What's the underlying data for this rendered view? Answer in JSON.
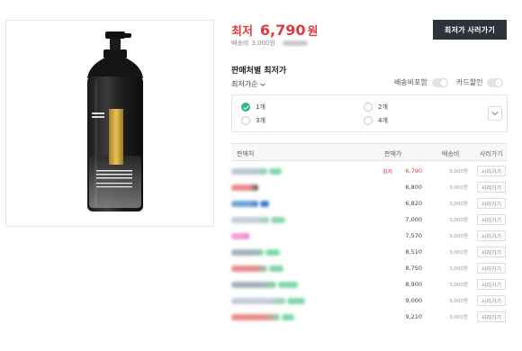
{
  "product": {
    "image_alt": "Product image"
  },
  "price": {
    "label": "최저",
    "value": "6,790",
    "unit": "원"
  },
  "shipping": {
    "label": "배송비",
    "value": "3,000원"
  },
  "buy_button": "최저가 사러가기",
  "section_title": "판매처별 최저가",
  "sort": {
    "label": "최저가순"
  },
  "toggles": [
    {
      "label": "배송비포함"
    },
    {
      "label": "카드할인"
    }
  ],
  "quantity_options": [
    {
      "label": "1개",
      "selected": true
    },
    {
      "label": "2개",
      "selected": false
    },
    {
      "label": "3개",
      "selected": false
    },
    {
      "label": "4개",
      "selected": false
    }
  ],
  "table": {
    "headers": {
      "seller": "판매처",
      "price": "판매가",
      "shipping": "배송비",
      "go": "사러가기"
    },
    "lowest_tag": "최저",
    "rows": [
      {
        "price": "6,790",
        "shipping": "3,000원",
        "go": "사러가기",
        "lowest": true,
        "seller_color": "#b9c7d6",
        "seller_accent": "#7fd7a8"
      },
      {
        "price": "6,800",
        "shipping": "3,000원",
        "go": "사러가기",
        "lowest": false,
        "seller_color": "#e88a8a",
        "seller_accent": "#555555"
      },
      {
        "price": "6,820",
        "shipping": "3,000원",
        "go": "사러가기",
        "lowest": false,
        "seller_color": "#6aa6d8",
        "seller_accent": "#3a7bd5"
      },
      {
        "price": "7,000",
        "shipping": "3,000원",
        "go": "사러가기",
        "lowest": false,
        "seller_color": "#c6ccd6",
        "seller_accent": "#8ad9b0"
      },
      {
        "price": "7,570",
        "shipping": "3,000원",
        "go": "사러가기",
        "lowest": false,
        "seller_color": "#f09ad8",
        "seller_accent": "#e86ac9"
      },
      {
        "price": "8,510",
        "shipping": "3,000원",
        "go": "사러가기",
        "lowest": false,
        "seller_color": "#a5b0bc",
        "seller_accent": "#7fd7a8"
      },
      {
        "price": "8,750",
        "shipping": "3,000원",
        "go": "사러가기",
        "lowest": false,
        "seller_color": "#e88a8a",
        "seller_accent": "#7fd7a8"
      },
      {
        "price": "8,900",
        "shipping": "3,000원",
        "go": "사러가기",
        "lowest": false,
        "seller_color": "#a5b0bc",
        "seller_accent": "#7fd7a8"
      },
      {
        "price": "9,000",
        "shipping": "3,000원",
        "go": "사러가기",
        "lowest": false,
        "seller_color": "#c6ccd6",
        "seller_accent": "#7fd7a8"
      },
      {
        "price": "9,210",
        "shipping": "3,000원",
        "go": "사러가기",
        "lowest": false,
        "seller_color": "#e88a8a",
        "seller_accent": "#7fd7a8"
      }
    ]
  },
  "colors": {
    "accent_red": "#e0393e",
    "dark_button": "#2e323a",
    "check_green": "#36b37e"
  }
}
